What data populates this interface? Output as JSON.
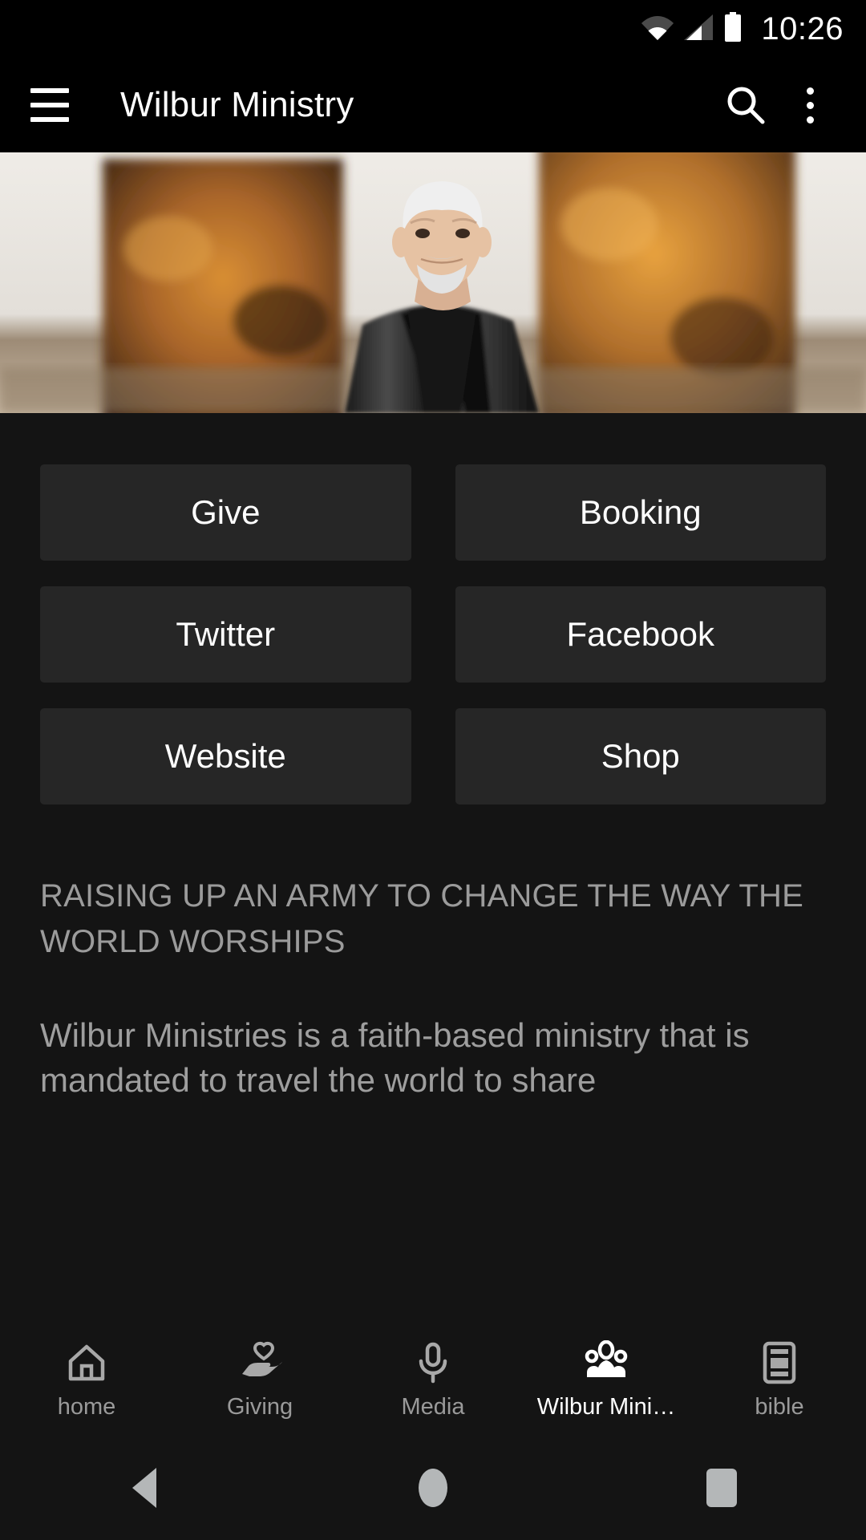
{
  "status_bar": {
    "time": "10:26",
    "icons": [
      "wifi-icon",
      "cellular-signal-icon",
      "battery-icon"
    ]
  },
  "app_bar": {
    "menu_icon": "hamburger-menu-icon",
    "title": "Wilbur Ministry",
    "search_icon": "search-icon",
    "overflow_icon": "overflow-menu-icon"
  },
  "hero": {
    "alt": "Man with white hair and beard in black leather jacket standing in a gallery with two orange abstract paintings"
  },
  "buttons": [
    {
      "label": "Give"
    },
    {
      "label": "Booking"
    },
    {
      "label": "Twitter"
    },
    {
      "label": "Facebook"
    },
    {
      "label": "Website"
    },
    {
      "label": "Shop"
    }
  ],
  "text_block": {
    "headline": "RAISING UP AN ARMY TO CHANGE THE WAY THE WORLD WORSHIPS",
    "body": "Wilbur Ministries is a faith-based ministry that is mandated to travel the world to share"
  },
  "tab_bar": {
    "items": [
      {
        "label": "home",
        "icon": "home-icon",
        "active": false
      },
      {
        "label": "Giving",
        "icon": "hand-heart-icon",
        "active": false
      },
      {
        "label": "Media",
        "icon": "microphone-icon",
        "active": false
      },
      {
        "label": "Wilbur Mini…",
        "icon": "people-group-icon",
        "active": true
      },
      {
        "label": "bible",
        "icon": "book-article-icon",
        "active": false
      }
    ]
  },
  "system_nav": {
    "back": "back-triangle-icon",
    "home": "home-circle-icon",
    "recents": "recents-square-icon"
  },
  "colors": {
    "page_background": "#141414",
    "app_bar_background": "#000000",
    "button_background": "#262626",
    "button_text": "#ffffff",
    "muted_text": "#9b9b9b",
    "active_tab_text": "#ffffff",
    "inactive_tab_text": "#9a9a9a"
  }
}
